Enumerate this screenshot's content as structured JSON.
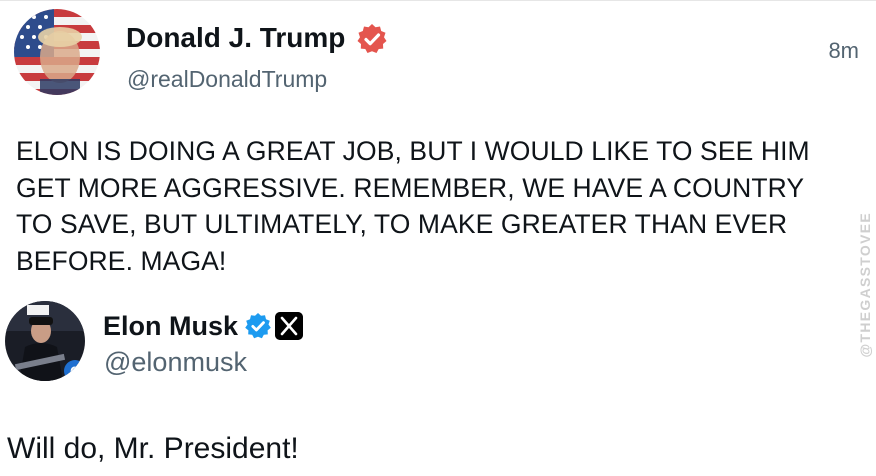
{
  "posts": [
    {
      "author_name": "Donald J. Trump",
      "author_handle": "@realDonaldTrump",
      "timestamp": "8m",
      "verified": true,
      "body_lines": [
        "ELON IS DOING A GREAT JOB, BUT I WOULD LIKE TO SEE HIM",
        "GET MORE AGGRESSIVE. REMEMBER, WE HAVE A COUNTRY",
        "TO SAVE, BUT ULTIMATELY, TO MAKE GREATER THAN EVER",
        "BEFORE. MAGA!"
      ]
    },
    {
      "author_name": "Elon Musk",
      "author_handle": "@elonmusk",
      "verified": true,
      "affiliation_icon": "x-logo-icon",
      "body": "Will do, Mr. President!"
    }
  ],
  "watermark": "@THEGASSTOVEE",
  "colors": {
    "text": "#0f1419",
    "secondary_text": "#536471",
    "truth_verified": "#e4554e",
    "x_verified": "#1d9bf0",
    "watermark": "#cfcfcf"
  }
}
